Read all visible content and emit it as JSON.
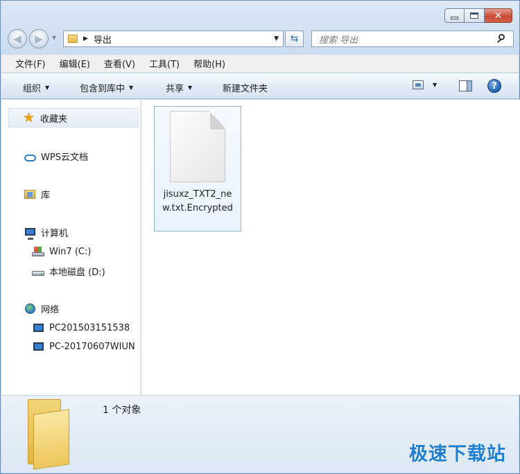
{
  "window": {
    "controls": {
      "minimize": "minimize",
      "maximize": "maximize",
      "close": "✕"
    }
  },
  "nav": {
    "address": "导出",
    "search_placeholder": "搜索 导出"
  },
  "menubar": {
    "items": [
      "文件(F)",
      "编辑(E)",
      "查看(V)",
      "工具(T)",
      "帮助(H)"
    ]
  },
  "toolbar": {
    "organize": "组织",
    "include_library": "包含到库中",
    "share": "共享",
    "new_folder": "新建文件夹"
  },
  "sidebar": {
    "favorites": "收藏夹",
    "wps_cloud": "WPS云文档",
    "libraries": "库",
    "computer": "计算机",
    "drive_c": "Win7 (C:)",
    "drive_d": "本地磁盘 (D:)",
    "network": "网络",
    "net_pc1": "PC201503151538",
    "net_pc2": "PC-20170607WIUN"
  },
  "files": [
    {
      "name": "jisuxz_TXT2_new.txt.Encrypted"
    }
  ],
  "details": {
    "summary": "1 个对象"
  },
  "watermark": "极速下载站"
}
